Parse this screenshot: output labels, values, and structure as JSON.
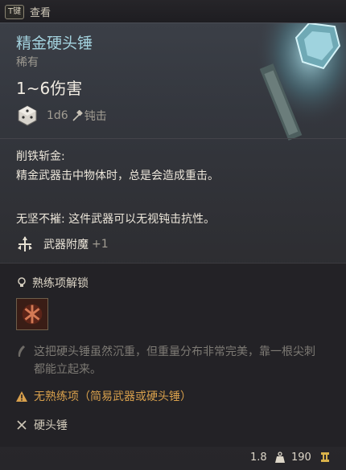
{
  "topbar": {
    "key_badge": "T键",
    "view_label": "查看"
  },
  "item": {
    "name": "精金硬头锤",
    "rarity": "稀有",
    "damage": "1~6伤害",
    "damage_formula": "1d6",
    "damage_type": "钝击",
    "ability_title": "削铁斩金:",
    "ability_desc": "精金武器击中物体时，总是会造成重击。",
    "passive": "无坚不摧: 这件武器可以无视钝击抗性。",
    "enchant_label": "武器附魔",
    "enchant_value": "+1"
  },
  "proficiency": {
    "unlock_label": "熟练项解锁",
    "flavor": "这把硬头锤虽然沉重，但重量分布非常完美，靠一根尖刺都能立起来。",
    "warning": "无熟练项（简易武器或硬头锤）",
    "weapon_type": "硬头锤"
  },
  "footer": {
    "weight": "1.8",
    "price": "190"
  },
  "colors": {
    "title": "#a3d2de",
    "warning": "#d8a04c",
    "muted": "#a29d93"
  },
  "icons": {
    "dice": "d6-dice-icon",
    "blunt": "blunt-damage-icon",
    "enchant": "weapon-enchant-icon",
    "unlock": "lightbulb-icon",
    "proficiency": "mace-proficiency-icon",
    "flavor": "quill-icon",
    "warning": "warning-triangle-icon",
    "type": "crossed-weapons-icon",
    "weight": "weight-icon",
    "gold": "gold-coin-icon"
  }
}
